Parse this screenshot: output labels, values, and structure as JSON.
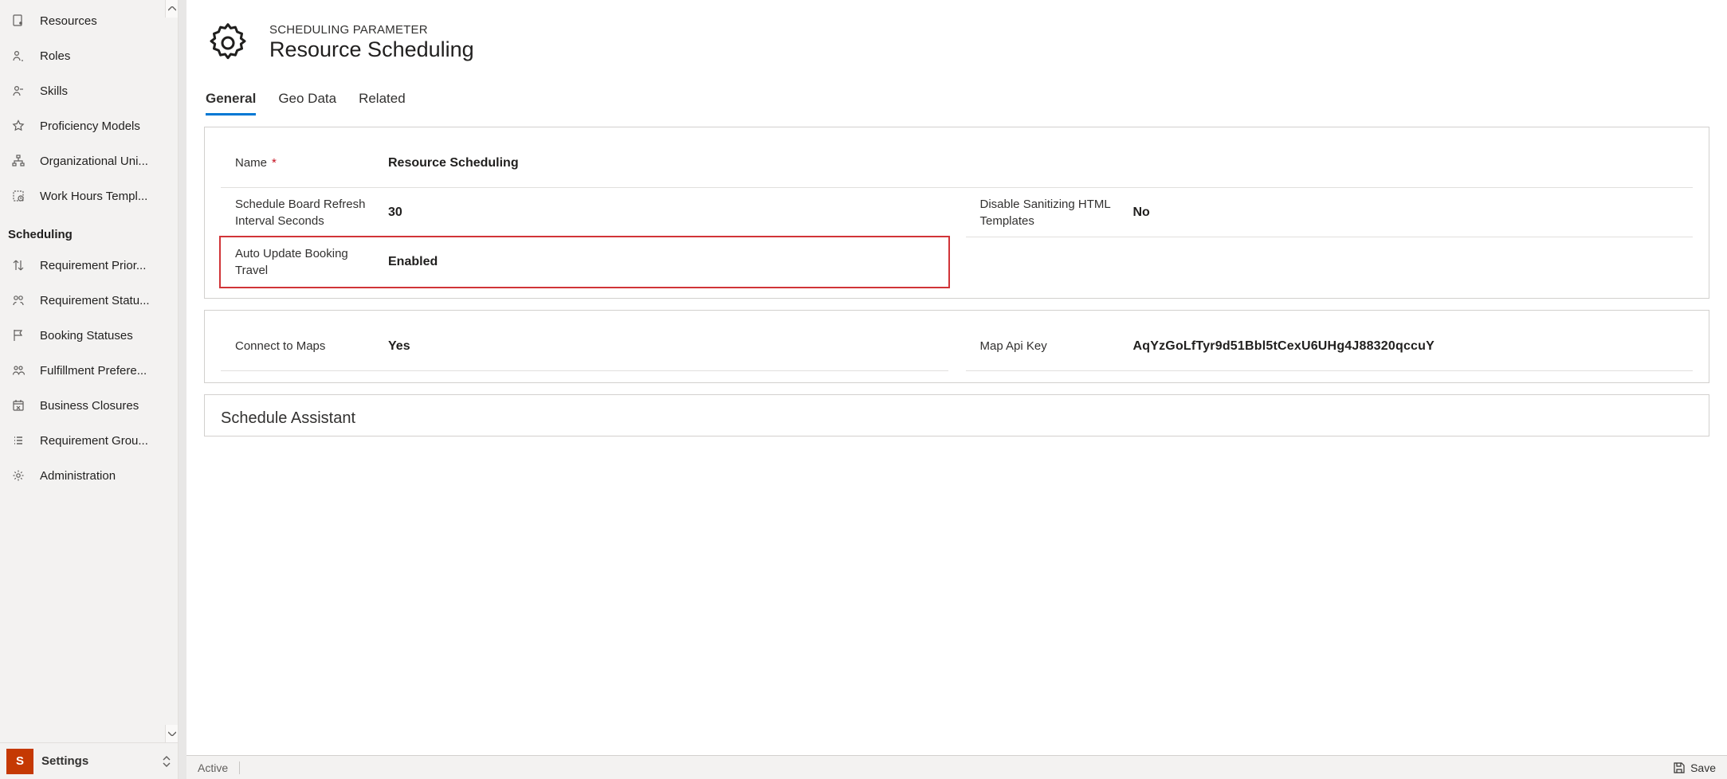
{
  "sidebar": {
    "items": [
      {
        "label": "Resources",
        "icon": "resources-icon"
      },
      {
        "label": "Roles",
        "icon": "roles-icon"
      },
      {
        "label": "Skills",
        "icon": "skills-icon"
      },
      {
        "label": "Proficiency Models",
        "icon": "star-icon"
      },
      {
        "label": "Organizational Uni...",
        "icon": "org-icon"
      },
      {
        "label": "Work Hours Templ...",
        "icon": "clock-icon"
      }
    ],
    "group_header": "Scheduling",
    "scheduling_items": [
      {
        "label": "Requirement Prior...",
        "icon": "priority-icon"
      },
      {
        "label": "Requirement Statu...",
        "icon": "status-icon"
      },
      {
        "label": "Booking Statuses",
        "icon": "flag-icon"
      },
      {
        "label": "Fulfillment Prefere...",
        "icon": "people-icon"
      },
      {
        "label": "Business Closures",
        "icon": "calendar-x-icon"
      },
      {
        "label": "Requirement Grou...",
        "icon": "list-icon"
      },
      {
        "label": "Administration",
        "icon": "gear-icon"
      }
    ],
    "area": {
      "tile": "S",
      "label": "Settings"
    }
  },
  "header": {
    "eyebrow": "SCHEDULING PARAMETER",
    "title": "Resource Scheduling"
  },
  "tabs": [
    {
      "label": "General",
      "active": true
    },
    {
      "label": "Geo Data",
      "active": false
    },
    {
      "label": "Related",
      "active": false
    }
  ],
  "fields": {
    "name_label": "Name",
    "name_value": "Resource Scheduling",
    "refresh_label": "Schedule Board Refresh Interval Seconds",
    "refresh_value": "30",
    "disable_sanitize_label": "Disable Sanitizing HTML Templates",
    "disable_sanitize_value": "No",
    "auto_update_label": "Auto Update Booking Travel",
    "auto_update_value": "Enabled",
    "connect_maps_label": "Connect to Maps",
    "connect_maps_value": "Yes",
    "map_api_key_label": "Map Api Key",
    "map_api_key_value": "AqYzGoLfTyr9d51Bbl5tCexU6UHg4J88320qccuY"
  },
  "section2": {
    "title": "Schedule Assistant"
  },
  "statusbar": {
    "status": "Active",
    "save_label": "Save"
  }
}
